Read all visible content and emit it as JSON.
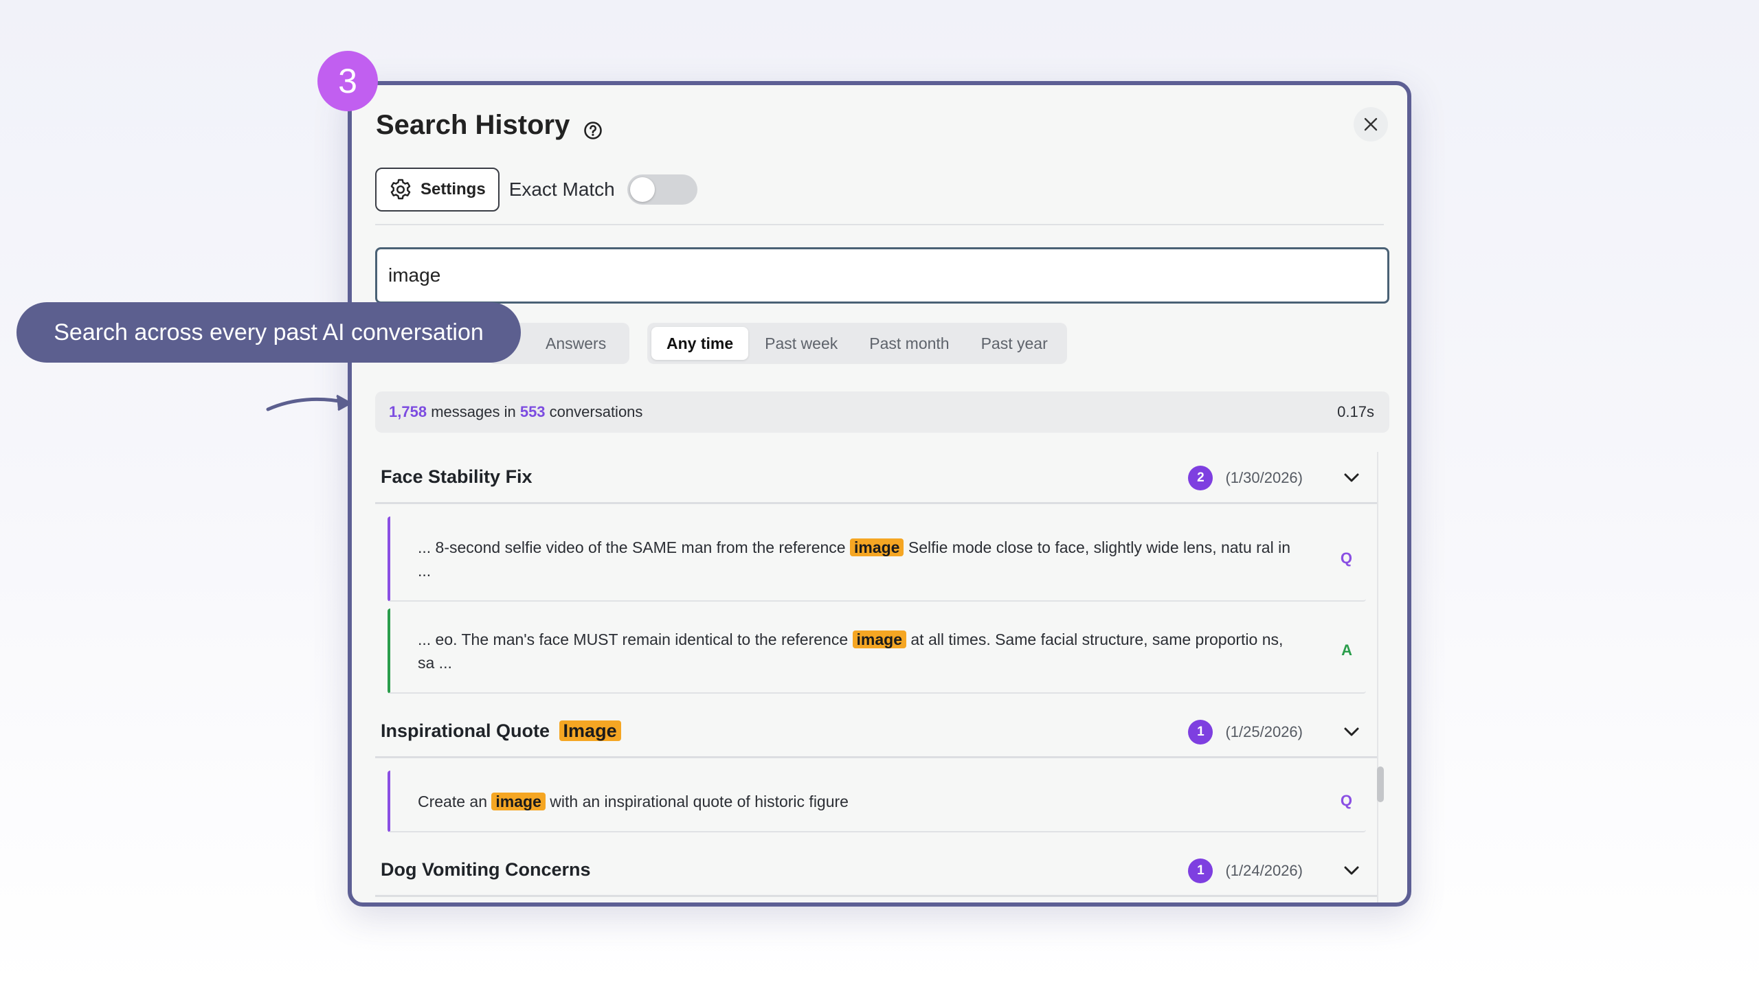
{
  "step_number": "3",
  "callout_text": "Search across every past AI conversation",
  "modal": {
    "title": "Search History",
    "settings_label": "Settings",
    "exact_match_label": "Exact Match",
    "exact_match_on": false,
    "search_value": "image",
    "type_tabs": [
      {
        "label": "Answers"
      }
    ],
    "time_tabs": [
      {
        "label": "Any time",
        "active": true
      },
      {
        "label": "Past week",
        "active": false
      },
      {
        "label": "Past month",
        "active": false
      },
      {
        "label": "Past year",
        "active": false
      }
    ],
    "stats": {
      "message_count": "1,758",
      "messages_in": "messages in",
      "conversation_count": "553",
      "conversations": "conversations",
      "time": "0.17s"
    }
  },
  "results": [
    {
      "title": "Face Stability Fix",
      "count": "2",
      "date": "(1/30/2026)",
      "messages": [
        {
          "role": "Q",
          "before": "... 8-second selfie video of the SAME man from the reference ",
          "match": "image",
          "after": " Selfie mode close to face, slightly wide lens, natu ral in ..."
        },
        {
          "role": "A",
          "before": "... eo. The man's face MUST remain identical to the reference ",
          "match": "image",
          "after": " at all times. Same facial structure, same proportio ns, sa ..."
        }
      ]
    },
    {
      "title": "Inspirational Quote",
      "title_match": "Image",
      "count": "1",
      "date": "(1/25/2026)",
      "messages": [
        {
          "role": "Q",
          "before": "Create an ",
          "match": "image",
          "after": " with an inspirational quote of historic figure"
        }
      ]
    },
    {
      "title": "Dog Vomiting Concerns",
      "count": "1",
      "date": "(1/24/2026)",
      "messages": []
    }
  ],
  "colors": {
    "accent": "#7e3fe0",
    "highlight": "#f5a623",
    "answer": "#2a9d4b",
    "frame": "#5d5f94",
    "step_badge": "#c15ff0"
  }
}
